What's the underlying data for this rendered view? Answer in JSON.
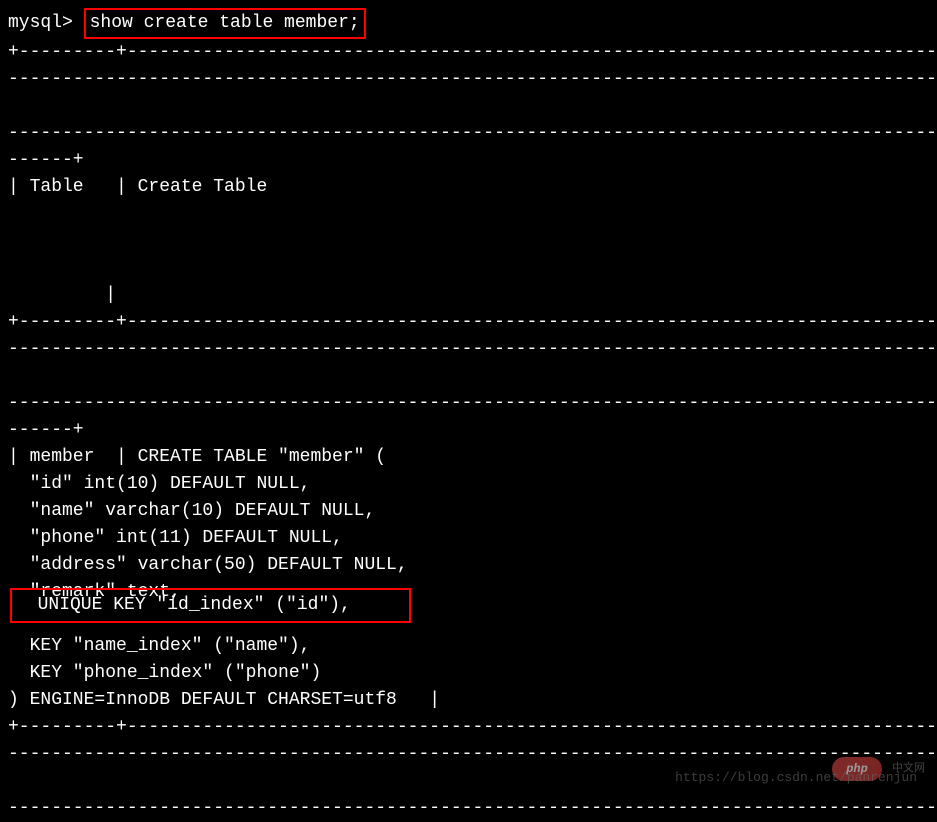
{
  "prompt": "mysql> ",
  "command": "show create table member;",
  "separator1": "+---------+----------------------------------------------------------------------------------------------------",
  "separator2": "-----------------------------------------------------------------------------------------------------------",
  "separator3": "-----------------------------------------------------------------------------------------------------------",
  "separator4": "------+",
  "header": "| Table   | Create Table",
  "spacer": "         |",
  "separator5": "+---------+----------------------------------------------------------------------------------------------------",
  "separator6": "-----------------------------------------------------------------------------------------------------------",
  "separator7": "-----------------------------------------------------------------------------------------------------------",
  "separator8": "------+",
  "result_line1": "| member  | CREATE TABLE \"member\" (",
  "result_line2": "  \"id\" int(10) DEFAULT NULL,",
  "result_line3": "  \"name\" varchar(10) DEFAULT NULL,",
  "result_line4": "  \"phone\" int(11) DEFAULT NULL,",
  "result_line5": "  \"address\" varchar(50) DEFAULT NULL,",
  "result_line6": "  \"remark\" text,",
  "result_line7_highlighted": "  UNIQUE KEY \"id_index\" (\"id\"),     ",
  "result_line8": "  KEY \"name_index\" (\"name\"),",
  "result_line9": "  KEY \"phone_index\" (\"phone\")",
  "result_line10": ") ENGINE=InnoDB DEFAULT CHARSET=utf8   |",
  "separator9": "+---------+----------------------------------------------------------------------------------------------------",
  "separator10": "-----------------------------------------------------------------------------------------------------------",
  "separator11": "-----------------------------------------------------------------------------------------------------------",
  "watermark_short": "中文网",
  "watermark_logo": "php",
  "watermark": "https://blog.csdn.net/panrenjun"
}
